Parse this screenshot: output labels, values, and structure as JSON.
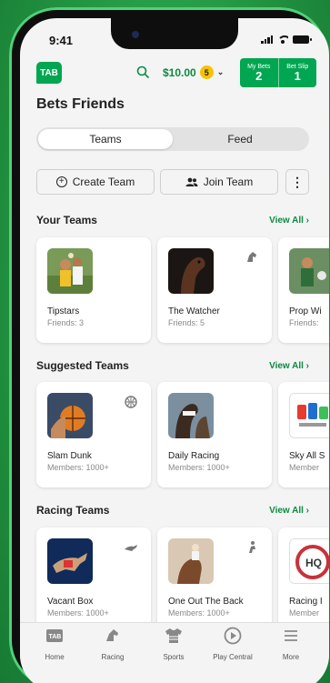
{
  "status": {
    "time": "9:41"
  },
  "header": {
    "logo": "TAB",
    "balance": "$10.00",
    "coin_count": "5",
    "my_bets_label": "My Bets",
    "my_bets_count": "2",
    "bet_slip_label": "Bet Slip",
    "bet_slip_count": "1"
  },
  "page": {
    "title": "Bets Friends"
  },
  "segments": {
    "teams": "Teams",
    "feed": "Feed"
  },
  "actions": {
    "create_team": "Create Team",
    "join_team": "Join Team",
    "more": "⋮"
  },
  "sections": [
    {
      "title": "Your Teams",
      "view_all": "View All",
      "cards": [
        {
          "name": "Tipstars",
          "sub": "Friends: 3",
          "image": "football-players-image"
        },
        {
          "name": "The Watcher",
          "sub": "Friends: 5",
          "image": "horse-image",
          "tag_icon": "horse-icon"
        },
        {
          "name": "Prop Wi",
          "sub": "Friends:",
          "image": "football-image"
        }
      ]
    },
    {
      "title": "Suggested Teams",
      "view_all": "View All",
      "cards": [
        {
          "name": "Slam Dunk",
          "sub": "Members: 1000+",
          "image": "basketball-image",
          "tag_icon": "basketball-icon"
        },
        {
          "name": "Daily Racing",
          "sub": "Members: 1000+",
          "image": "horses-image"
        },
        {
          "name": "Sky All S",
          "sub": "Member",
          "image": "sky-sport-logo"
        }
      ]
    },
    {
      "title": "Racing Teams",
      "view_all": "View All",
      "cards": [
        {
          "name": "Vacant Box",
          "sub": "Members: 1000+",
          "image": "greyhound-image",
          "tag_icon": "greyhound-icon"
        },
        {
          "name": "One Out The Back",
          "sub": "Members: 1000+",
          "image": "jockey-image",
          "tag_icon": "jockey-icon"
        },
        {
          "name": "Racing I",
          "sub": "Member",
          "image": "racing-hq-logo"
        }
      ]
    }
  ],
  "bottom_nav": [
    {
      "label": "Home",
      "icon": "tab-home-icon"
    },
    {
      "label": "Racing",
      "icon": "racing-icon"
    },
    {
      "label": "Sports",
      "icon": "sports-shirt-icon"
    },
    {
      "label": "Play Central",
      "icon": "play-icon"
    },
    {
      "label": "More",
      "icon": "menu-icon"
    }
  ],
  "colors": {
    "brand_green": "#00a651",
    "link_green": "#0b8a40",
    "coin_yellow": "#f5c400"
  }
}
